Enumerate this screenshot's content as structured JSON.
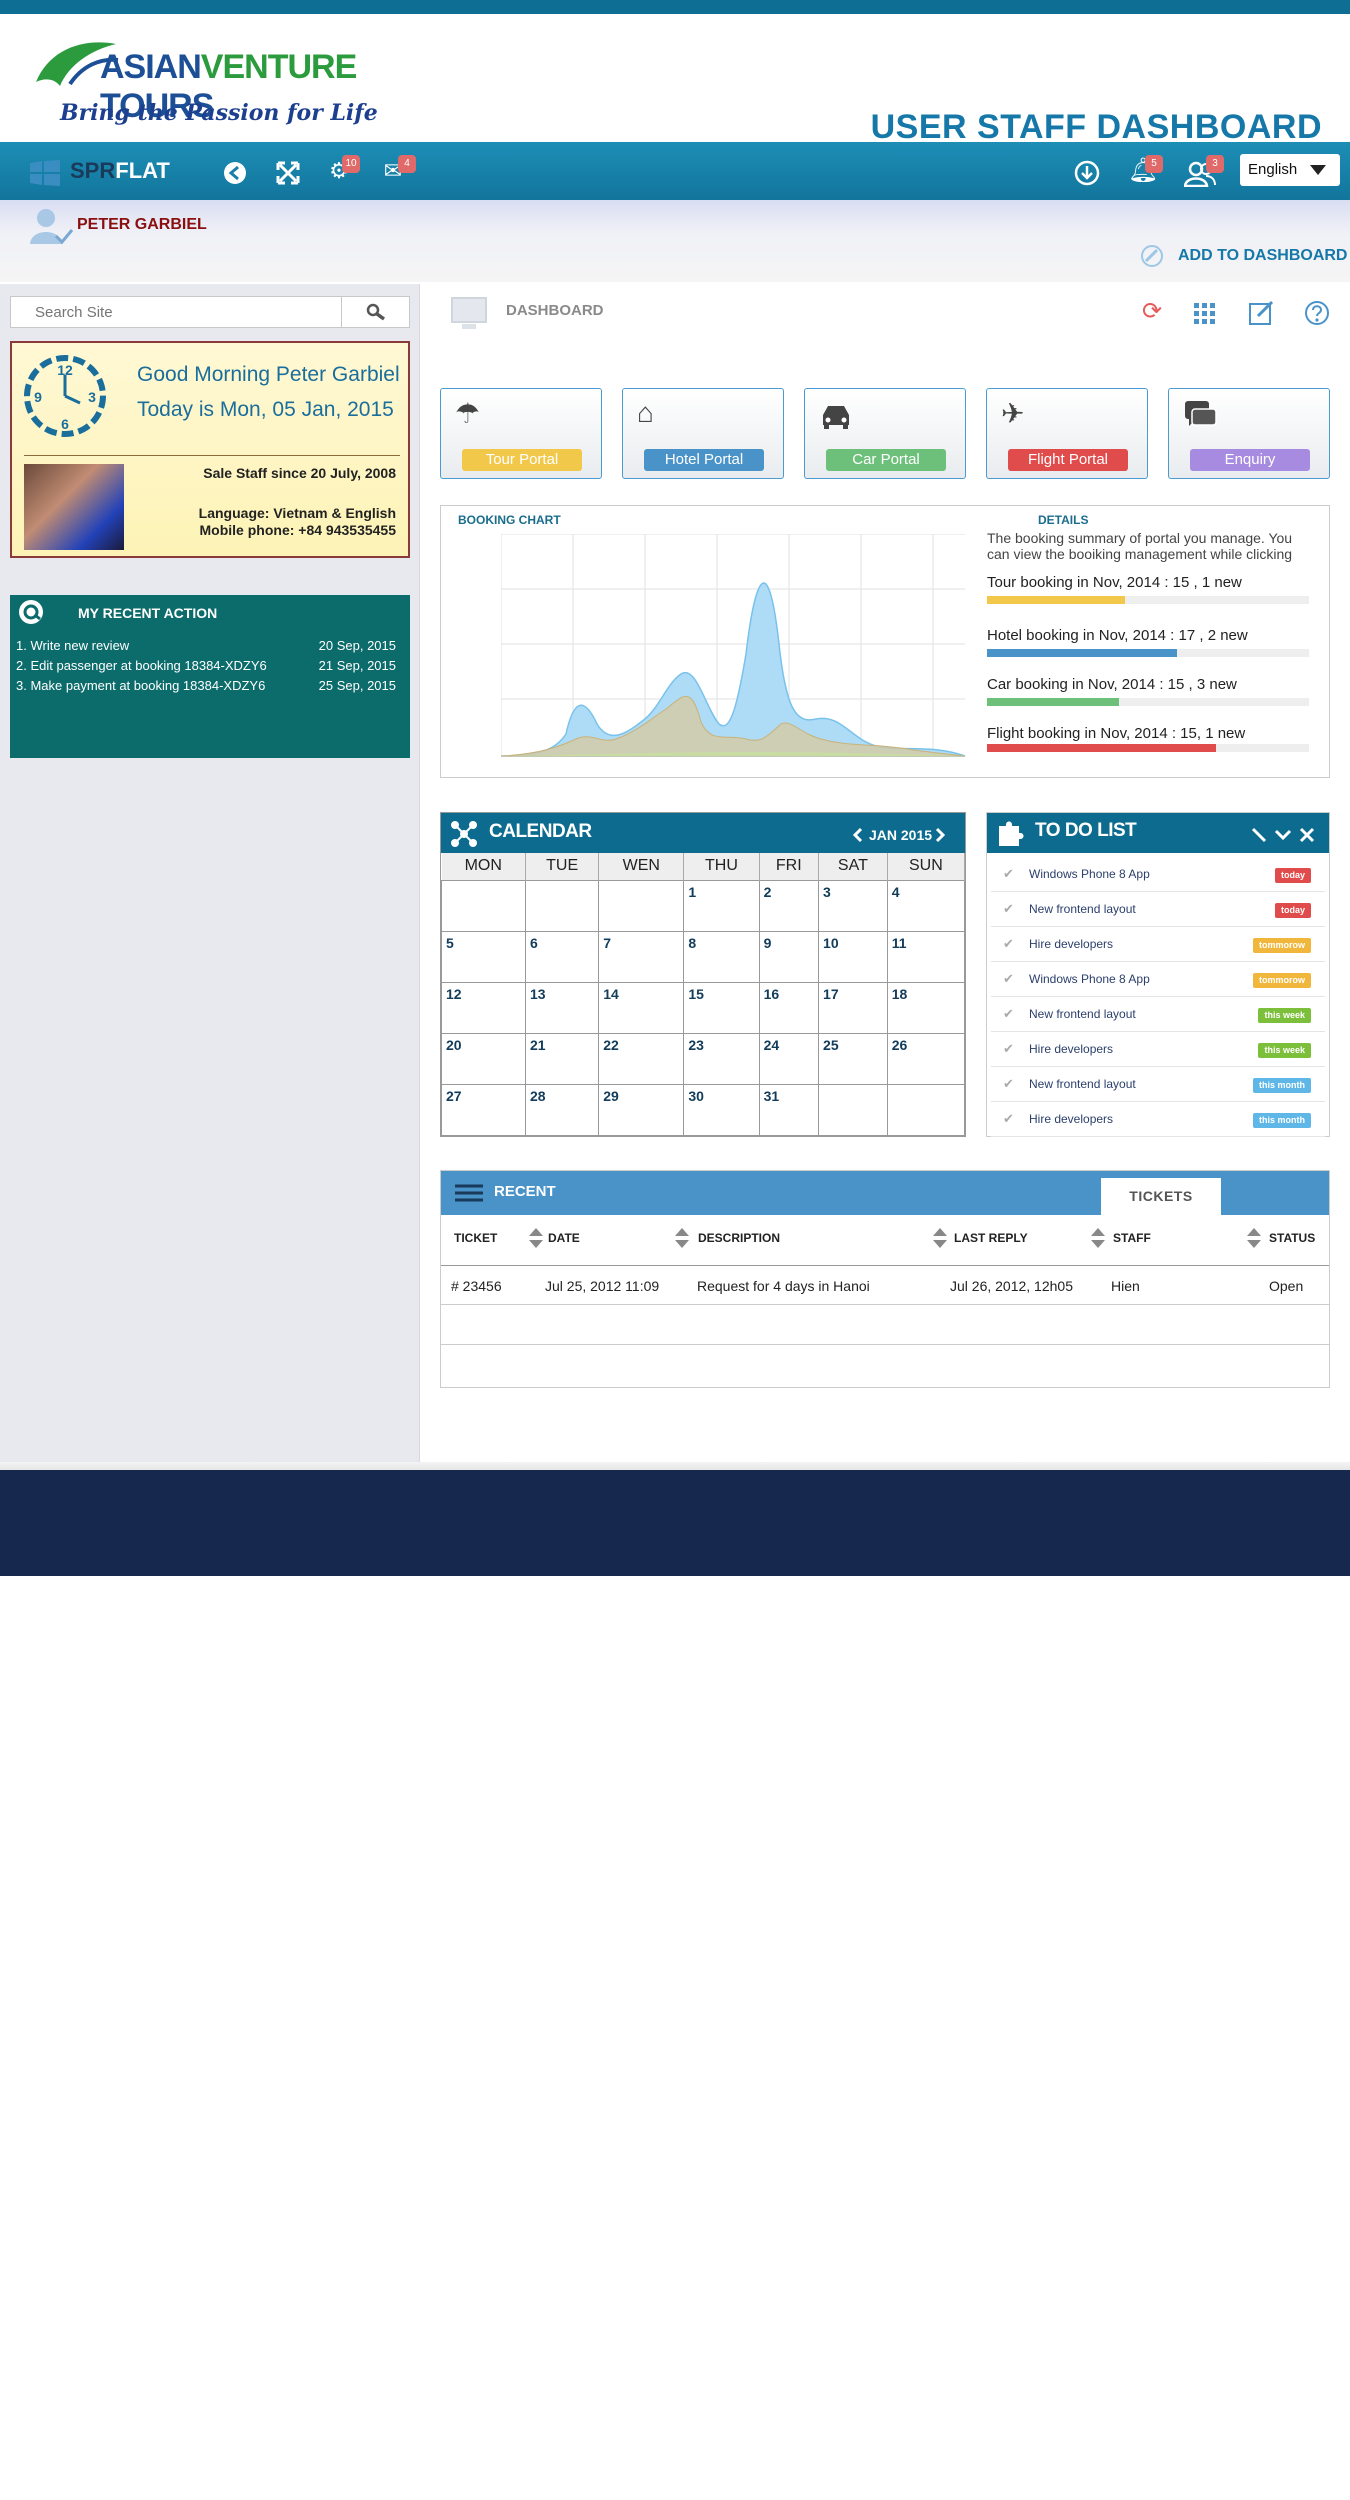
{
  "logo": {
    "brand_part1": "ASIAN",
    "brand_part2": "VENTURE",
    "brand_part3": " TOURS",
    "tagline": "Bring the Passion for Life"
  },
  "header": {
    "title": "USER STAFF DASHBOARD"
  },
  "navbar": {
    "brand_part1": "SPR",
    "brand_part2": "FLAT",
    "settings_badge": "10",
    "mail_badge": "4",
    "notifications_badge": "5",
    "users_badge": "3",
    "language": "English"
  },
  "user": {
    "name": "PETER GARBIEL",
    "add_to_dashboard": "ADD TO DASHBOARD"
  },
  "search": {
    "placeholder": "Search Site"
  },
  "greeting": {
    "line1": "Good Morning  Peter Garbiel",
    "line2": "Today is Mon, 05 Jan, 2015",
    "role": "Sale Staff  since  20 July, 2008",
    "language": "Language: Vietnam & English",
    "mobile": "Mobile phone: +84 943535455",
    "clock": {
      "n12": "12",
      "n3": "3",
      "n6": "6",
      "n9": "9"
    }
  },
  "recent_actions": {
    "title": "MY RECENT ACTION",
    "items": [
      {
        "text": "1. Write new review",
        "date": "20 Sep, 2015"
      },
      {
        "text": "2. Edit passenger at booking 18384-XDZY6",
        "date": "21 Sep, 2015"
      },
      {
        "text": "3. Make payment at booking 18384-XDZY6",
        "date": "25 Sep, 2015"
      }
    ]
  },
  "dashboard": {
    "label": "DASHBOARD"
  },
  "portals": [
    {
      "label": "Tour  Portal",
      "color": "#f2c84b",
      "icon": "umbrella-icon"
    },
    {
      "label": "Hotel Portal",
      "color": "#4a93c9",
      "icon": "hotel-icon"
    },
    {
      "label": "Car Portal",
      "color": "#6cc07a",
      "icon": "car-icon"
    },
    {
      "label": "Flight Portal",
      "color": "#e04b4b",
      "icon": "plane-icon"
    },
    {
      "label": "Enquiry",
      "color": "#a68be0",
      "icon": "chat-icon"
    }
  ],
  "booking_chart": {
    "title": "BOOKING CHART",
    "details_title": "DETAILS",
    "details_text": "The booking summary of portal you manage. You can view the booiking management while clicking",
    "items": [
      {
        "label": "Tour booking in Nov, 2014 : 15 , 1 new",
        "color": "#f2c84b",
        "fraction": 0.43
      },
      {
        "label": "Hotel  booking in Nov, 2014 : 17 , 2 new",
        "color": "#4a93c9",
        "fraction": 0.59
      },
      {
        "label": "Car booking in Nov, 2014 : 15 ,  3 new",
        "color": "#6cc07a",
        "fraction": 0.41
      },
      {
        "label": "Flight  booking in Nov, 2014 : 15, 1 new",
        "color": "#e04b4b",
        "fraction": 0.71
      }
    ]
  },
  "calendar": {
    "title": "CALENDAR",
    "month": "JAN 2015",
    "weekdays": [
      "MON",
      "TUE",
      "WEN",
      "THU",
      "FRI",
      "SAT",
      "SUN"
    ],
    "weeks": [
      [
        "",
        "",
        "",
        "1",
        "2",
        "3",
        "4"
      ],
      [
        "5",
        "6",
        "7",
        "8",
        "9",
        "10",
        "11"
      ],
      [
        "12",
        "13",
        "14",
        "15",
        "16",
        "17",
        "18"
      ],
      [
        "20",
        "21",
        "22",
        "23",
        "24",
        "25",
        "26"
      ],
      [
        "27",
        "28",
        "29",
        "30",
        "31",
        "",
        ""
      ]
    ]
  },
  "todo": {
    "title": "TO DO LIST",
    "items": [
      {
        "text": "Windows Phone 8 App",
        "tag": "today",
        "color": "#e04b4b"
      },
      {
        "text": "New frontend layout",
        "tag": "today",
        "color": "#e04b4b"
      },
      {
        "text": "Hire developers",
        "tag": "tommorow",
        "color": "#f0b73c"
      },
      {
        "text": "Windows Phone 8 App",
        "tag": "tommorow",
        "color": "#f0b73c"
      },
      {
        "text": "New frontend layout",
        "tag": "this week",
        "color": "#7cbf3a"
      },
      {
        "text": "Hire developers",
        "tag": "this week",
        "color": "#7cbf3a"
      },
      {
        "text": "New frontend layout",
        "tag": "this month",
        "color": "#5fb7e8"
      },
      {
        "text": "Hire developers",
        "tag": "this month",
        "color": "#5fb7e8"
      }
    ]
  },
  "recent": {
    "title": "RECENT",
    "tab": "TICKETS",
    "columns": [
      "TICKET",
      "DATE",
      "DESCRIPTION",
      "LAST REPLY",
      "STAFF",
      "STATUS"
    ],
    "rows": [
      [
        "# 23456",
        "Jul 25, 2012 11:09",
        "Request for 4 days in Hanoi",
        "Jul 26, 2012, 12h05",
        "Hien",
        "Open"
      ]
    ]
  }
}
